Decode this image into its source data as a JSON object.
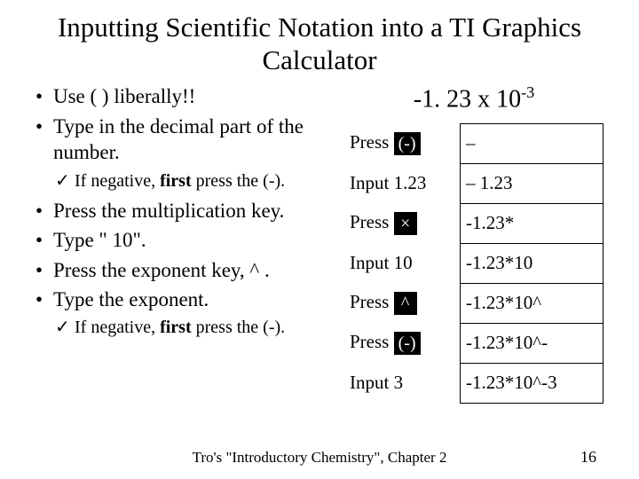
{
  "title": "Inputting Scientific Notation into a TI Graphics Calculator",
  "example": {
    "prefix": "-1. 23 x 10",
    "exp": "-3"
  },
  "bullets": {
    "b1": "Use ( ) liberally!!",
    "b2": "Type in the decimal part of the number.",
    "s1a": "If negative, ",
    "s1b": "first",
    "s1c": " press the (-).",
    "b3": "Press the multiplication key.",
    "b4": "Type \" 10\".",
    "b5": "Press the exponent key, ^ .",
    "b6": "Type the exponent.",
    "s2a": "If negative, ",
    "s2b": "first",
    "s2c": " press the (-)."
  },
  "rows": {
    "r1a": "Press",
    "r1k": "(-)",
    "r1d": "–",
    "r2a": "Input 1.23",
    "r2d": "– 1.23",
    "r3a": "Press",
    "r3k": "×",
    "r3d": "-1.23*",
    "r4a": "Input 10",
    "r4d": "-1.23*10",
    "r5a": "Press",
    "r5k": "^",
    "r5d": "-1.23*10^",
    "r6a": "Press",
    "r6k": "(-)",
    "r6d": "-1.23*10^-",
    "r7a": "Input 3",
    "r7d": "-1.23*10^-3"
  },
  "footer": "Tro's \"Introductory Chemistry\", Chapter 2",
  "page": "16"
}
